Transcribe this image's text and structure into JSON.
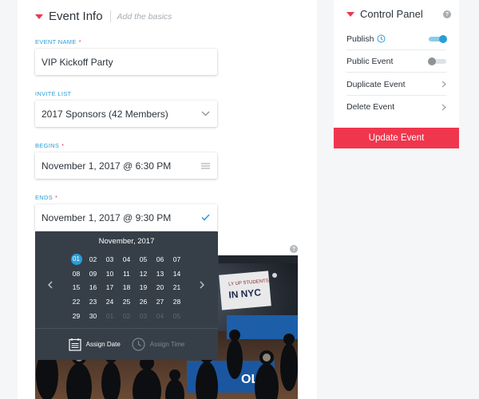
{
  "event_info": {
    "title": "Event Info",
    "subtitle": "Add the basics",
    "event_name": {
      "label": "EVENT NAME",
      "required": "*",
      "value": "VIP Kickoff Party"
    },
    "invite_list": {
      "label": "INVITE LIST",
      "value": "2017 Sponsors (42 Members)"
    },
    "begins": {
      "label": "BEGINS",
      "required": "*",
      "value": "November 1, 2017 @ 6:30 PM"
    },
    "ends": {
      "label": "ENDS",
      "required": "*",
      "value": "November 1, 2017 @ 9:30 PM"
    }
  },
  "datepicker": {
    "month_label": "November, 2017",
    "selected_day": "01",
    "days": [
      {
        "d": "01",
        "state": "selected"
      },
      {
        "d": "02",
        "state": "normal"
      },
      {
        "d": "03",
        "state": "normal"
      },
      {
        "d": "04",
        "state": "normal"
      },
      {
        "d": "05",
        "state": "normal"
      },
      {
        "d": "06",
        "state": "normal"
      },
      {
        "d": "07",
        "state": "normal"
      },
      {
        "d": "08",
        "state": "normal"
      },
      {
        "d": "09",
        "state": "normal"
      },
      {
        "d": "10",
        "state": "normal"
      },
      {
        "d": "11",
        "state": "normal"
      },
      {
        "d": "12",
        "state": "normal"
      },
      {
        "d": "13",
        "state": "normal"
      },
      {
        "d": "14",
        "state": "normal"
      },
      {
        "d": "15",
        "state": "normal"
      },
      {
        "d": "16",
        "state": "normal"
      },
      {
        "d": "17",
        "state": "normal"
      },
      {
        "d": "18",
        "state": "normal"
      },
      {
        "d": "19",
        "state": "normal"
      },
      {
        "d": "20",
        "state": "normal"
      },
      {
        "d": "21",
        "state": "normal"
      },
      {
        "d": "22",
        "state": "normal"
      },
      {
        "d": "23",
        "state": "normal"
      },
      {
        "d": "24",
        "state": "normal"
      },
      {
        "d": "25",
        "state": "normal"
      },
      {
        "d": "26",
        "state": "normal"
      },
      {
        "d": "27",
        "state": "normal"
      },
      {
        "d": "28",
        "state": "normal"
      },
      {
        "d": "29",
        "state": "normal"
      },
      {
        "d": "30",
        "state": "normal"
      },
      {
        "d": "01",
        "state": "dim"
      },
      {
        "d": "02",
        "state": "dim"
      },
      {
        "d": "03",
        "state": "dim"
      },
      {
        "d": "04",
        "state": "dim"
      },
      {
        "d": "05",
        "state": "dim"
      }
    ],
    "assign_date_label": "Assign Date",
    "assign_time_label": "Assign Time"
  },
  "photo": {
    "banner_text": "IN NYC",
    "banner_small": "LY UP STUDENTS",
    "table_text": "OLA"
  },
  "control_panel": {
    "title": "Control Panel",
    "rows": [
      {
        "label": "Publish",
        "control": "toggle",
        "state": "on"
      },
      {
        "label": "Public Event",
        "control": "toggle",
        "state": "off"
      },
      {
        "label": "Duplicate Event",
        "control": "chevron"
      },
      {
        "label": "Delete Event",
        "control": "chevron"
      }
    ],
    "update_button": "Update Event"
  },
  "colors": {
    "accent_blue": "#2a9dd8",
    "accent_red": "#e8384f",
    "update_button": "#f0364d",
    "picker_bg": "#363f48"
  },
  "icons": [
    "caret-down-icon",
    "chevron-down-icon",
    "menu-lines-icon",
    "checkmark-icon",
    "arrow-left-icon",
    "arrow-right-icon",
    "calendar-icon",
    "clock-icon",
    "help-icon",
    "chevron-right-icon"
  ]
}
